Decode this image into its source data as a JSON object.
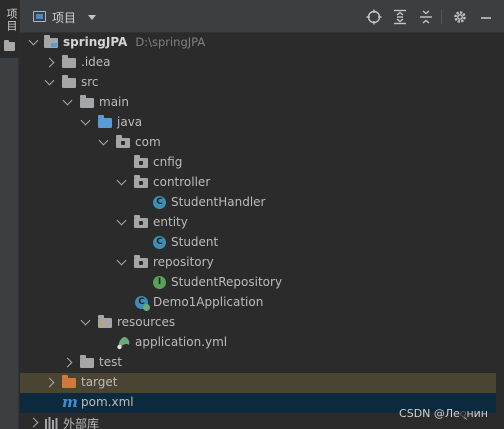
{
  "sidebar": {
    "tab_label": "项目"
  },
  "header": {
    "title": "项目"
  },
  "tree": {
    "root": {
      "name": "springJPA",
      "path": "D:\\springJPA"
    },
    "nodes": {
      "idea": ".idea",
      "src": "src",
      "main": "main",
      "java": "java",
      "com": "com",
      "cnfig": "cnfig",
      "controller": "controller",
      "student_handler": "StudentHandler",
      "entity": "entity",
      "student": "Student",
      "repository": "repository",
      "student_repository": "StudentRepository",
      "demo1_application": "Demo1Application",
      "resources": "resources",
      "application_yml": "application.yml",
      "test": "test",
      "target": "target",
      "pom_xml": "pom.xml",
      "external_libs": "外部库"
    },
    "badges": {
      "class": "C",
      "interface": "I",
      "maven": "m"
    }
  },
  "watermark": "CSDN @Ле्нин",
  "colors": {
    "class_icon": "#3d8fb8",
    "interface_icon": "#5aa05a",
    "source_folder": "#5a9bd5",
    "excluded_folder": "#d1783c",
    "selection_target": "#4a4433",
    "selection_pom": "#0d293e"
  }
}
